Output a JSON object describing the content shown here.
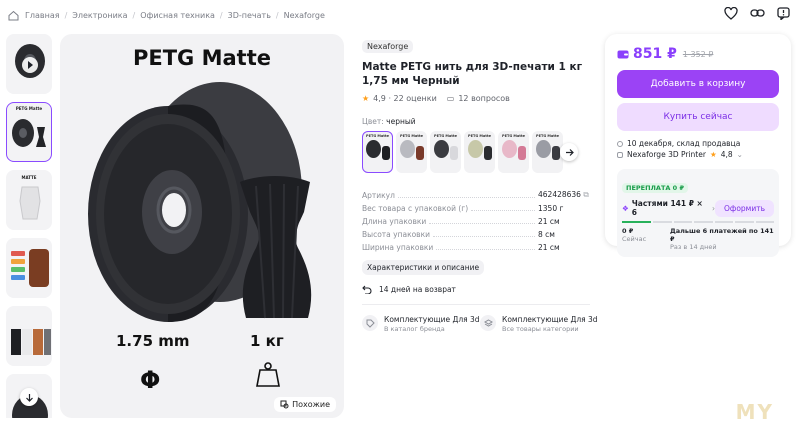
{
  "breadcrumb": [
    "Главная",
    "Электроника",
    "Офисная техника",
    "3D-печать",
    "Nexaforge"
  ],
  "gallery": {
    "title": "PETG Matte",
    "diameter": "1.75 mm",
    "weight": "1 кг",
    "similar_label": "Похожие",
    "thumb_matte": "MATTE",
    "thumb_petg": "PETG Matte"
  },
  "product": {
    "brand": "Nexaforge",
    "title": "Matte PETG нить для 3D-печати 1 кг 1,75 мм Черный",
    "rating": "4,9 · 22 оценки",
    "questions": "12 вопросов",
    "color_label": "Цвет:",
    "color_value": "черный",
    "swatches": [
      {
        "spool": "#2b2c30",
        "vase": "#1d1e22"
      },
      {
        "spool": "#b9bac0",
        "vase": "#7a3a2a"
      },
      {
        "spool": "#3a3b40",
        "vase": "#d8d8dc"
      },
      {
        "spool": "#c7c8a8",
        "vase": "#2b2c30"
      },
      {
        "spool": "#e8b8c8",
        "vase": "#d47a96"
      },
      {
        "spool": "#9a9ca4",
        "vase": "#3b3c42"
      }
    ],
    "specs": [
      {
        "k": "Артикул",
        "v": "462428636"
      },
      {
        "k": "Вес товара с упаковкой (г)",
        "v": "1350 г"
      },
      {
        "k": "Длина упаковки",
        "v": "21 см"
      },
      {
        "k": "Высота упаковки",
        "v": "8 см"
      },
      {
        "k": "Ширина упаковки",
        "v": "21 см"
      }
    ],
    "chip": "Характеристики и описание",
    "returns": "14 дней на возврат",
    "bundles": [
      {
        "t1": "Комплектующие Для 3d",
        "t2": "В каталог бренда"
      },
      {
        "t1": "Комплектующие Для 3d",
        "t2": "Все товары категории"
      }
    ]
  },
  "buy": {
    "price": "851 ₽",
    "old_price": "1 352 ₽",
    "cart_btn": "Добавить в корзину",
    "buy_btn": "Купить сейчас",
    "delivery": "10 декабря, склад продавца",
    "seller": "Nexaforge 3D Printer",
    "seller_rating": "4,8",
    "overpay": "ПЕРЕПЛАТА 0 ₽",
    "parts": "Частями 141 ₽ × 6",
    "order_btn": "Оформить",
    "pay_now_amount": "0 ₽",
    "pay_now_label": "Сейчас",
    "pay_later_amount": "Дальше 6 платежей по 141 ₽",
    "pay_later_label": "Раз в 14 дней",
    "accent": "#9b43f5"
  }
}
